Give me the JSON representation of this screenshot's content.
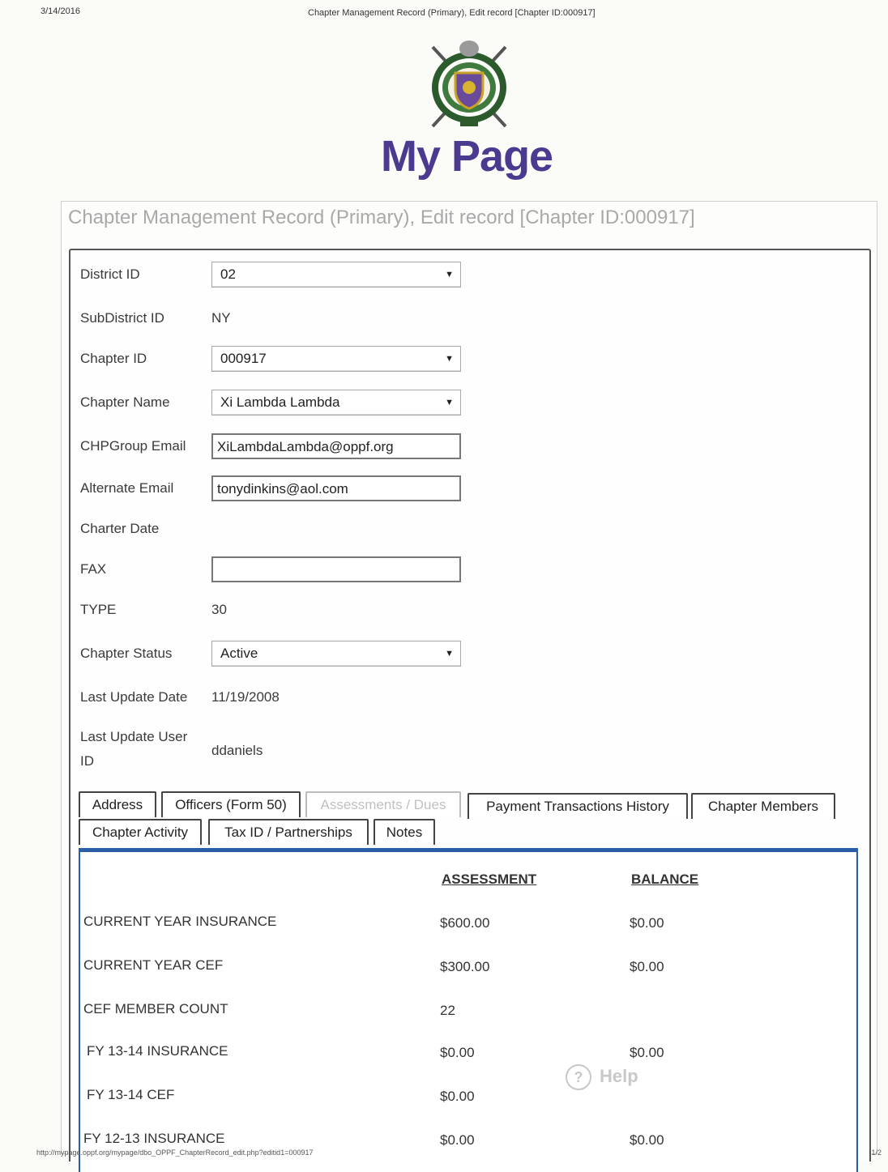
{
  "print": {
    "date": "3/14/2016",
    "title": "Chapter Management Record (Primary), Edit record [Chapter ID:000917]",
    "url": "http://mypage.oppf.org/mypage/dbo_OPPF_ChapterRecord_edit.php?editid1=000917",
    "page": "1/2"
  },
  "brand": {
    "title": "My Page"
  },
  "panel": {
    "title": "Chapter Management Record (Primary), Edit record [Chapter ID:000917]"
  },
  "form": {
    "district_id": {
      "label": "District ID",
      "value": "02"
    },
    "subdistrict_id": {
      "label": "SubDistrict ID",
      "value": "NY"
    },
    "chapter_id": {
      "label": "Chapter ID",
      "value": "000917"
    },
    "chapter_name": {
      "label": "Chapter Name",
      "value": "Xi Lambda Lambda"
    },
    "chpgroup_email": {
      "label": "CHPGroup Email",
      "value": "XiLambdaLambda@oppf.org"
    },
    "alternate_email": {
      "label": "Alternate Email",
      "value": "tonydinkins@aol.com"
    },
    "charter_date": {
      "label": "Charter Date",
      "value": ""
    },
    "fax": {
      "label": "FAX",
      "value": ""
    },
    "type": {
      "label": "TYPE",
      "value": "30"
    },
    "chapter_status": {
      "label": "Chapter Status",
      "value": "Active"
    },
    "last_update_date": {
      "label": "Last Update Date",
      "value": "11/19/2008"
    },
    "last_update_user": {
      "label_line1": "Last Update User",
      "label_line2": "ID",
      "value": "ddaniels"
    }
  },
  "tabs": {
    "address": "Address",
    "officers": "Officers (Form 50)",
    "assessments": "Assessments / Dues",
    "payments": "Payment Transactions History",
    "members": "Chapter Members",
    "activity": "Chapter Activity",
    "taxid": "Tax ID / Partnerships",
    "notes": "Notes"
  },
  "dues": {
    "col_assessment": "ASSESSMENT",
    "col_balance": "BALANCE",
    "rows": [
      {
        "label": "CURRENT YEAR INSURANCE",
        "assessment": "$600.00",
        "balance": "$0.00"
      },
      {
        "label": "CURRENT YEAR CEF",
        "assessment": "$300.00",
        "balance": "$0.00"
      },
      {
        "label": "CEF MEMBER COUNT",
        "assessment": "22",
        "balance": ""
      },
      {
        "label": "FY 13-14 INSURANCE",
        "assessment": "$0.00",
        "balance": "$0.00"
      },
      {
        "label": "FY 13-14 CEF",
        "assessment": "$0.00",
        "balance": ""
      },
      {
        "label": "FY 12-13 INSURANCE",
        "assessment": "$0.00",
        "balance": "$0.00"
      }
    ]
  },
  "help": {
    "label": "Help",
    "icon": "?"
  },
  "colors": {
    "brand": "#4b3a8f",
    "tab_border": "#2a5fa8"
  }
}
